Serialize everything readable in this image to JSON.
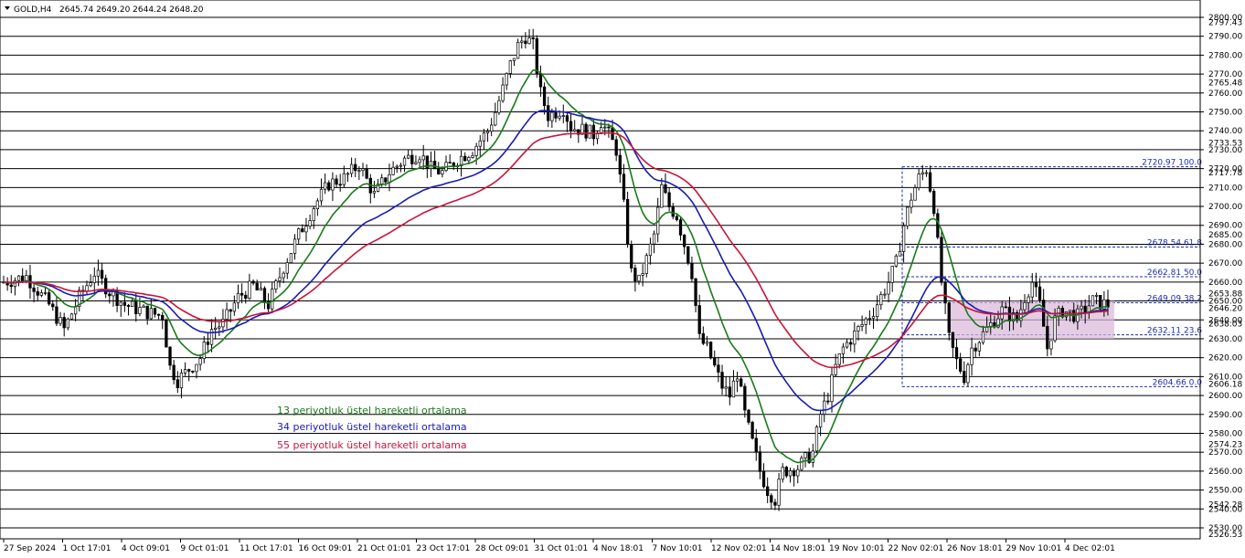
{
  "header": {
    "symbol": "GOLD,H4",
    "ohlc": "2645.74 2649.20 2644.24 2648.20"
  },
  "chart_data": {
    "type": "candlestick",
    "title": "GOLD,H4",
    "ylim": [
      2526.53,
      2800.0
    ],
    "price_ticks": [
      2800,
      2790,
      2780,
      2770,
      2760,
      2750,
      2740,
      2730,
      2720,
      2710,
      2700,
      2690,
      2680,
      2670,
      2660,
      2650,
      2640,
      2630,
      2620,
      2610,
      2600,
      2590,
      2580,
      2570,
      2560,
      2550,
      2540,
      2530
    ],
    "extra_price_labels": [
      "2797.43",
      "2765.48",
      "2733.53",
      "2717.78",
      "2685.00",
      "2653.88",
      "2646.20",
      "2638.03",
      "2606.18",
      "2574.23",
      "2542.28",
      "2526.53"
    ],
    "extra_price_values": [
      2797.43,
      2765.48,
      2733.53,
      2717.78,
      2685.0,
      2653.88,
      2646.2,
      2638.03,
      2606.18,
      2574.23,
      2542.28,
      2526.53
    ],
    "x_labels": [
      "27 Sep 2024",
      "1 Oct 17:01",
      "4 Oct 09:01",
      "9 Oct 01:01",
      "11 Oct 17:01",
      "16 Oct 09:01",
      "21 Oct 01:01",
      "23 Oct 17:01",
      "28 Oct 09:01",
      "31 Oct 01:01",
      "4 Nov 18:01",
      "7 Nov 10:01",
      "12 Nov 02:01",
      "14 Nov 18:01",
      "19 Nov 10:01",
      "22 Nov 02:01",
      "26 Nov 18:01",
      "29 Nov 10:01",
      "4 Dec 02:01"
    ],
    "series_legend": [
      {
        "name": "13 periyotluk üstel hareketli ortalama",
        "color": "#1a7a1a"
      },
      {
        "name": "34 periyotluk üstel hareketli ortalama",
        "color": "#1a1ab4"
      },
      {
        "name": "55 periyotluk üstel hareketli ortalama",
        "color": "#c8143c"
      }
    ],
    "price_path": [
      [
        0,
        2660
      ],
      [
        6,
        2663
      ],
      [
        12,
        2648
      ],
      [
        16,
        2635
      ],
      [
        20,
        2652
      ],
      [
        24,
        2665
      ],
      [
        28,
        2655
      ],
      [
        32,
        2648
      ],
      [
        38,
        2644
      ],
      [
        42,
        2642
      ],
      [
        44,
        2615
      ],
      [
        46,
        2608
      ],
      [
        48,
        2612
      ],
      [
        52,
        2620
      ],
      [
        55,
        2635
      ],
      [
        58,
        2638
      ],
      [
        62,
        2652
      ],
      [
        66,
        2658
      ],
      [
        70,
        2648
      ],
      [
        74,
        2668
      ],
      [
        78,
        2685
      ],
      [
        82,
        2700
      ],
      [
        86,
        2712
      ],
      [
        90,
        2715
      ],
      [
        94,
        2722
      ],
      [
        98,
        2706
      ],
      [
        102,
        2718
      ],
      [
        106,
        2725
      ],
      [
        110,
        2728
      ],
      [
        113,
        2720
      ],
      [
        116,
        2718
      ],
      [
        120,
        2725
      ],
      [
        124,
        2730
      ],
      [
        128,
        2740
      ],
      [
        130,
        2750
      ],
      [
        132,
        2762
      ],
      [
        134,
        2775
      ],
      [
        136,
        2785
      ],
      [
        138,
        2790
      ],
      [
        140,
        2785
      ],
      [
        142,
        2760
      ],
      [
        144,
        2748
      ],
      [
        148,
        2752
      ],
      [
        150,
        2742
      ],
      [
        154,
        2740
      ],
      [
        156,
        2738
      ],
      [
        158,
        2745
      ],
      [
        160,
        2738
      ],
      [
        162,
        2730
      ],
      [
        164,
        2700
      ],
      [
        166,
        2665
      ],
      [
        168,
        2660
      ],
      [
        170,
        2672
      ],
      [
        172,
        2685
      ],
      [
        174,
        2710
      ],
      [
        176,
        2700
      ],
      [
        178,
        2695
      ],
      [
        180,
        2680
      ],
      [
        182,
        2665
      ],
      [
        184,
        2630
      ],
      [
        186,
        2625
      ],
      [
        188,
        2615
      ],
      [
        190,
        2605
      ],
      [
        192,
        2600
      ],
      [
        194,
        2612
      ],
      [
        196,
        2590
      ],
      [
        198,
        2575
      ],
      [
        200,
        2560
      ],
      [
        202,
        2550
      ],
      [
        204,
        2545
      ],
      [
        206,
        2560
      ],
      [
        210,
        2562
      ],
      [
        214,
        2570
      ],
      [
        216,
        2590
      ],
      [
        218,
        2600
      ],
      [
        220,
        2615
      ],
      [
        222,
        2625
      ],
      [
        226,
        2635
      ],
      [
        230,
        2645
      ],
      [
        234,
        2660
      ],
      [
        236,
        2670
      ],
      [
        238,
        2690
      ],
      [
        240,
        2705
      ],
      [
        242,
        2715
      ],
      [
        244,
        2720
      ],
      [
        246,
        2700
      ],
      [
        248,
        2660
      ],
      [
        250,
        2630
      ],
      [
        252,
        2618
      ],
      [
        254,
        2610
      ],
      [
        256,
        2625
      ],
      [
        258,
        2630
      ],
      [
        262,
        2640
      ],
      [
        264,
        2645
      ],
      [
        268,
        2640
      ],
      [
        270,
        2652
      ],
      [
        272,
        2660
      ],
      [
        274,
        2648
      ],
      [
        276,
        2625
      ],
      [
        278,
        2640
      ],
      [
        280,
        2645
      ],
      [
        284,
        2642
      ],
      [
        288,
        2650
      ],
      [
        292,
        2648
      ]
    ],
    "fibonacci": [
      {
        "label": "2720.97 100.0",
        "value": 2720.97
      },
      {
        "label": "2678.54 61.8",
        "value": 2678.54
      },
      {
        "label": "2662.81 50.0",
        "value": 2662.81
      },
      {
        "label": "2649.09 38.2",
        "value": 2649.09
      },
      {
        "label": "2632.11 23.6",
        "value": 2632.11
      },
      {
        "label": "2604.66 0.0",
        "value": 2604.66
      }
    ]
  }
}
